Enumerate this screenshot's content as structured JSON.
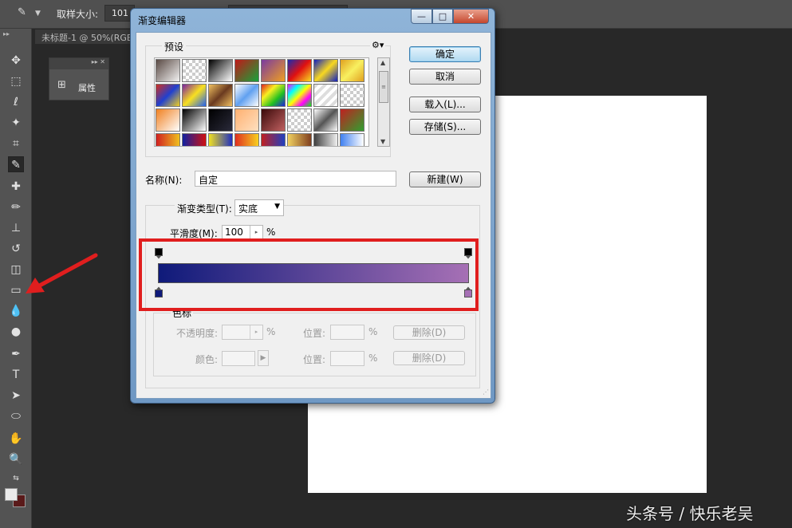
{
  "app": {
    "options_bar": {
      "sample_size_label": "取样大小:",
      "sample_size_value": "101"
    },
    "document_tab": "未标题-1 @ 50%(RGB",
    "properties_panel": {
      "label": "属性"
    }
  },
  "dialog": {
    "title": "渐变编辑器",
    "window_buttons": {
      "minimize": "—",
      "maximize": "□",
      "close": "✕"
    },
    "presets": {
      "label": "预设",
      "swatches": [
        "linear-gradient(135deg,#5a4a44,#f2f2f2)",
        "repeating-conic-gradient(#ccc 0 25%,#fff 0 50%) 0 0/8px 8px",
        "linear-gradient(135deg,#000,#fff)",
        "linear-gradient(135deg,#c01818,#16a33a)",
        "linear-gradient(135deg,#7a3aa0,#f0a020)",
        "linear-gradient(135deg,#1a2ab0,#e01010,#f8e020)",
        "linear-gradient(135deg,#1020c0,#f8d820,#1020c0)",
        "linear-gradient(135deg,#e0a020,#f8f060,#e0a020)",
        "linear-gradient(135deg,#d03020,#2040d0,#f0d020)",
        "linear-gradient(135deg,#7a20a0,#f8e020,#2060f0)",
        "linear-gradient(135deg,#f0c060,#6a3a20,#f0c060)",
        "linear-gradient(135deg,#fff,#60a0f0,#fff)",
        "linear-gradient(135deg,#e02020,#f8f020,#20c020,#2020e0)",
        "linear-gradient(135deg,#f0f,#0ff,#ff0,#f0f,#0f0)",
        "repeating-linear-gradient(135deg,#ddd 0 4px,#fff 4px 8px)",
        "repeating-conic-gradient(#ccc 0 25%,#fff 0 50%) 0 0/8px 8px",
        "linear-gradient(135deg,#f08020,#fff)",
        "linear-gradient(135deg,#000,#fff)",
        "linear-gradient(135deg,#000,#2a2a3a)",
        "linear-gradient(135deg,#ffb070,#ffe0c0)",
        "linear-gradient(135deg,#3a0a0a,#c06060)",
        "repeating-conic-gradient(#ccc 0 25%,#fff 0 50%) 0 0/8px 8px",
        "linear-gradient(135deg,#fff,#555,#fff)",
        "linear-gradient(135deg,#c02020,#30a030)",
        "linear-gradient(90deg,#d02020,#f0c020)",
        "linear-gradient(90deg,#1020a0,#d01010)",
        "linear-gradient(90deg,#f0e020,#2030c0)",
        "linear-gradient(90deg,#e03020,#f8d020)",
        "linear-gradient(90deg,#c02020,#2040c0)",
        "linear-gradient(90deg,#f0d060,#804020)",
        "linear-gradient(90deg,#404040,#f0f0f0)",
        "linear-gradient(90deg,#4080f0,#fff)"
      ]
    },
    "buttons": {
      "ok": "确定",
      "cancel": "取消",
      "load": "载入(L)...",
      "save": "存储(S)...",
      "new": "新建(W)"
    },
    "name": {
      "label": "名称(N):",
      "value": "自定"
    },
    "gradient_type": {
      "label": "渐变类型(T):",
      "value": "实底"
    },
    "smoothness": {
      "label": "平滑度(M):",
      "value": "100",
      "unit": "%"
    },
    "gradient": {
      "start_color": "#0f1a7a",
      "end_color": "#a670b5"
    },
    "color_stops": {
      "group_label": "色标",
      "opacity_label": "不透明度:",
      "opacity_unit": "%",
      "position_label_1": "位置:",
      "position_unit_1": "%",
      "delete_label_1": "删除(D)",
      "color_label": "颜色:",
      "position_label_2": "位置:",
      "position_unit_2": "%",
      "delete_label_2": "删除(D)"
    }
  },
  "annotations": {
    "highlight_color": "#e01e1e",
    "arrow_color": "#e01e1e"
  },
  "watermark": "头条号 / 快乐老吴"
}
